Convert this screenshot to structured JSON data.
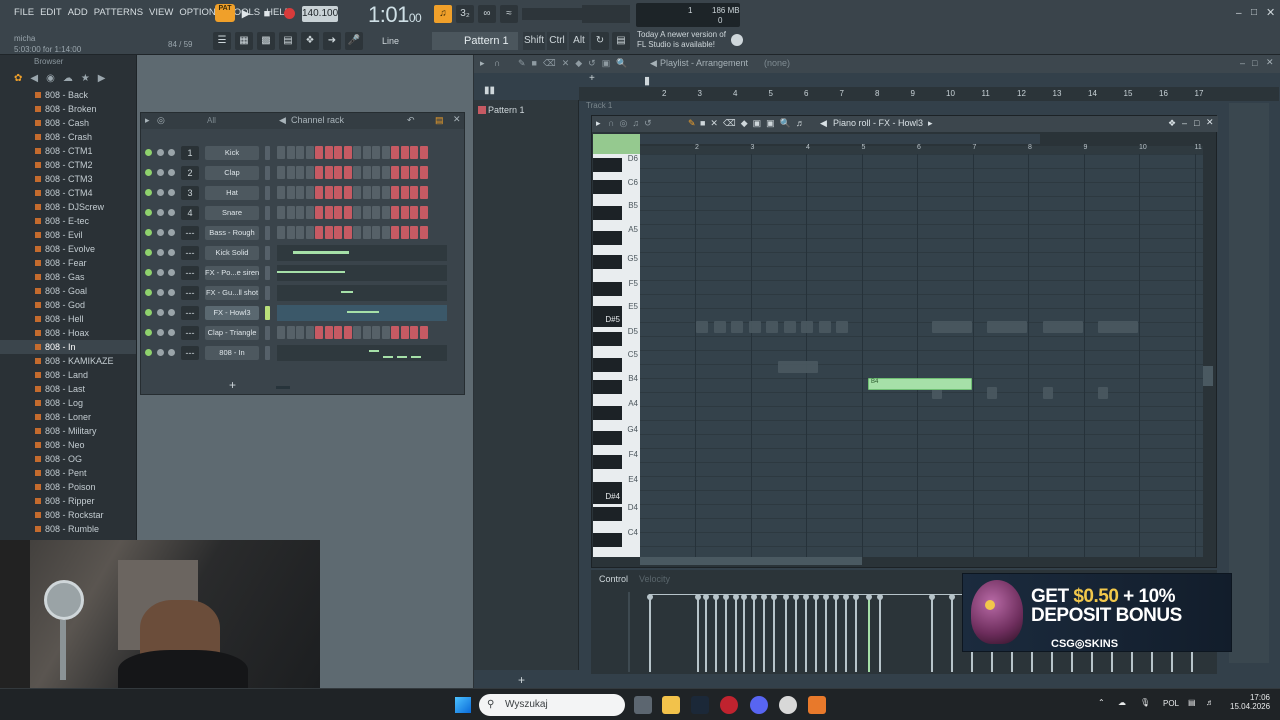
{
  "menu": [
    "FILE",
    "EDIT",
    "ADD",
    "PATTERNS",
    "VIEW",
    "OPTIONS",
    "TOOLS",
    "HELP"
  ],
  "hint": {
    "user": "micha",
    "position": "5:03:00 for 1:14:00",
    "ratio": "84 / 59"
  },
  "transport": {
    "pat_label": "PAT",
    "song_label": "SONG",
    "tempo": "140.100",
    "time_main": "1:01",
    "time_sub": "00"
  },
  "meter": {
    "cpu": "1",
    "ram": "186 MB",
    "poly": "0"
  },
  "toolbar": {
    "snap": "Line",
    "pattern": "Pattern 1",
    "shift": "Shift",
    "ctrl": "Ctrl",
    "alt": "Alt"
  },
  "news": {
    "line1": "Today  A newer version of",
    "line2": "FL Studio is available!"
  },
  "browser": {
    "title": "Browser",
    "items": [
      "808 - Back",
      "808 - Broken",
      "808 - Cash",
      "808 - Crash",
      "808 - CTM1",
      "808 - CTM2",
      "808 - CTM3",
      "808 - CTM4",
      "808 - DJScrew",
      "808 - E-tec",
      "808 - Evil",
      "808 - Evolve",
      "808 - Fear",
      "808 - Gas",
      "808 - Goal",
      "808 - God",
      "808 - Hell",
      "808 - Hoax",
      "808 - In",
      "808 - KAMIKAZE",
      "808 - Land",
      "808 - Last",
      "808 - Log",
      "808 - Loner",
      "808 - Military",
      "808 - Neo",
      "808 - OG",
      "808 - Pent",
      "808 - Poison",
      "808 - Ripper",
      "808 - Rockstar",
      "808 - Rumble"
    ],
    "selected_index": 18
  },
  "rack": {
    "title": "Channel rack",
    "filter": "All",
    "channels": [
      {
        "num": "1",
        "name": "Kick",
        "mode": "steps"
      },
      {
        "num": "2",
        "name": "Clap",
        "mode": "steps"
      },
      {
        "num": "3",
        "name": "Hat",
        "mode": "steps"
      },
      {
        "num": "4",
        "name": "Snare",
        "mode": "steps"
      },
      {
        "num": "---",
        "name": "Bass - Rough",
        "mode": "steps"
      },
      {
        "num": "---",
        "name": "Kick Solid",
        "mode": "mini"
      },
      {
        "num": "---",
        "name": "FX - Po...e siren",
        "mode": "mini"
      },
      {
        "num": "---",
        "name": "FX - Gu...ll shot",
        "mode": "mini"
      },
      {
        "num": "---",
        "name": "FX - Howl3",
        "mode": "mini"
      },
      {
        "num": "---",
        "name": "Clap - Triangle",
        "mode": "steps"
      },
      {
        "num": "---",
        "name": "808 - In",
        "mode": "mini"
      }
    ],
    "add": "+"
  },
  "patterns": {
    "items": [
      "Pattern 1"
    ]
  },
  "playlist": {
    "title": "Playlist - Arrangement",
    "sub": "(none)",
    "track": "Track 1",
    "bars": [
      "2",
      "3",
      "4",
      "5",
      "6",
      "7",
      "8",
      "9",
      "10",
      "11",
      "12",
      "13",
      "14",
      "15",
      "16",
      "17"
    ]
  },
  "pianoroll": {
    "title": "Piano roll - FX - Howl3",
    "bars": [
      "2",
      "3",
      "4",
      "5",
      "6",
      "7",
      "8",
      "9",
      "10",
      "11"
    ],
    "key_labels": [
      {
        "label": "D6"
      },
      {
        "label": "C6"
      },
      {
        "label": "B5"
      },
      {
        "label": "A5"
      },
      {
        "label": "G5"
      },
      {
        "label": "F5"
      },
      {
        "label": "E5"
      },
      {
        "label": "D#5"
      },
      {
        "label": "D5"
      },
      {
        "label": "C5"
      },
      {
        "label": "B4"
      },
      {
        "label": "A4"
      },
      {
        "label": "G4"
      },
      {
        "label": "F4"
      },
      {
        "label": "E4"
      },
      {
        "label": "D#4"
      },
      {
        "label": "D4"
      },
      {
        "label": "C4"
      }
    ],
    "note_label": "B4"
  },
  "control": {
    "label": "Control",
    "velocity_label": "Velocity"
  },
  "ad": {
    "line1_a": "GET ",
    "line1_b": "$0.50",
    "line1_c": " + 10%",
    "line2": "DEPOSIT BONUS",
    "brand": "CSG◎SKINS"
  },
  "taskbar": {
    "search": "Wyszukaj",
    "lang": "POL",
    "time": "17:06",
    "date": "15.04.2026"
  },
  "colors": {
    "accent": "#f0a02a",
    "note": "#a6e0a8",
    "step_on": "#c65a63",
    "step_off": "#566168"
  }
}
